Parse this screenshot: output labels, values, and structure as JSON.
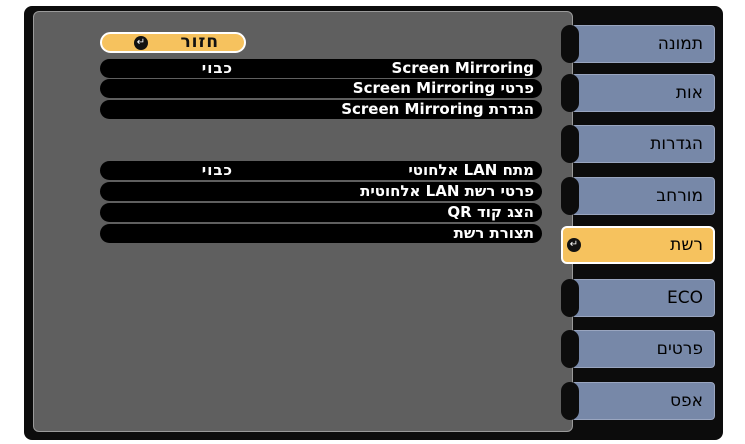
{
  "menu": {
    "return_label": "חזור",
    "return_icon": "enter-icon",
    "rows": [
      {
        "label": "Screen Mirroring",
        "value": "כבוי"
      },
      {
        "label": "פרטי Screen Mirroring",
        "value": ""
      },
      {
        "label": "הגדרת Screen Mirroring",
        "value": ""
      },
      {
        "label": "מתח LAN אלחוטי",
        "value": "כבוי"
      },
      {
        "label": "פרטי רשת LAN אלחוטית",
        "value": ""
      },
      {
        "label": "הצג קוד QR",
        "value": ""
      },
      {
        "label": "תצורת רשת",
        "value": ""
      }
    ]
  },
  "tabs": [
    {
      "label": "תמונה"
    },
    {
      "label": "אות"
    },
    {
      "label": "הגדרות"
    },
    {
      "label": "מורחב"
    },
    {
      "label": "רשת",
      "active": true
    },
    {
      "label": "ECO"
    },
    {
      "label": "פרטים"
    },
    {
      "label": "אפס"
    }
  ],
  "colors": {
    "accent": "#f6c25e",
    "tab": "#7788a8",
    "panel": "#5f5f5f",
    "frame": "#0c0c0c"
  }
}
